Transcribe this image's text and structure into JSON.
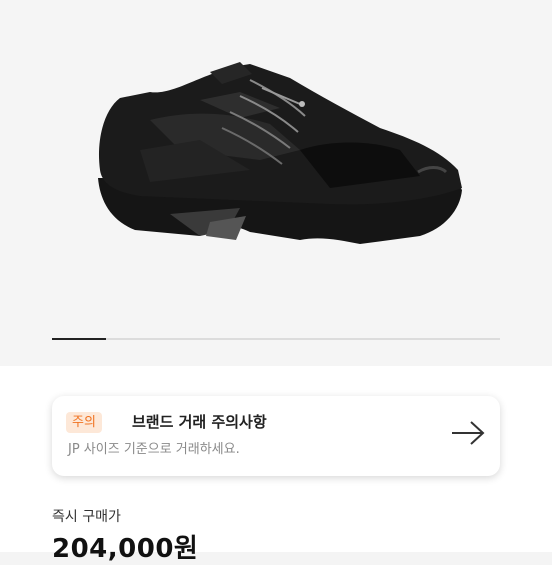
{
  "product": {
    "image_icon": "sneaker-photo",
    "pager": {
      "current": 1,
      "progress": 0.12
    }
  },
  "notice": {
    "badge": "주의",
    "title": "브랜드 거래 주의사항",
    "description": "JP 사이즈 기준으로 거래하세요.",
    "arrow_icon": "arrow-right-icon",
    "accent_color": "#f07322"
  },
  "price": {
    "label": "즉시 구매가",
    "value": "204,000원"
  }
}
